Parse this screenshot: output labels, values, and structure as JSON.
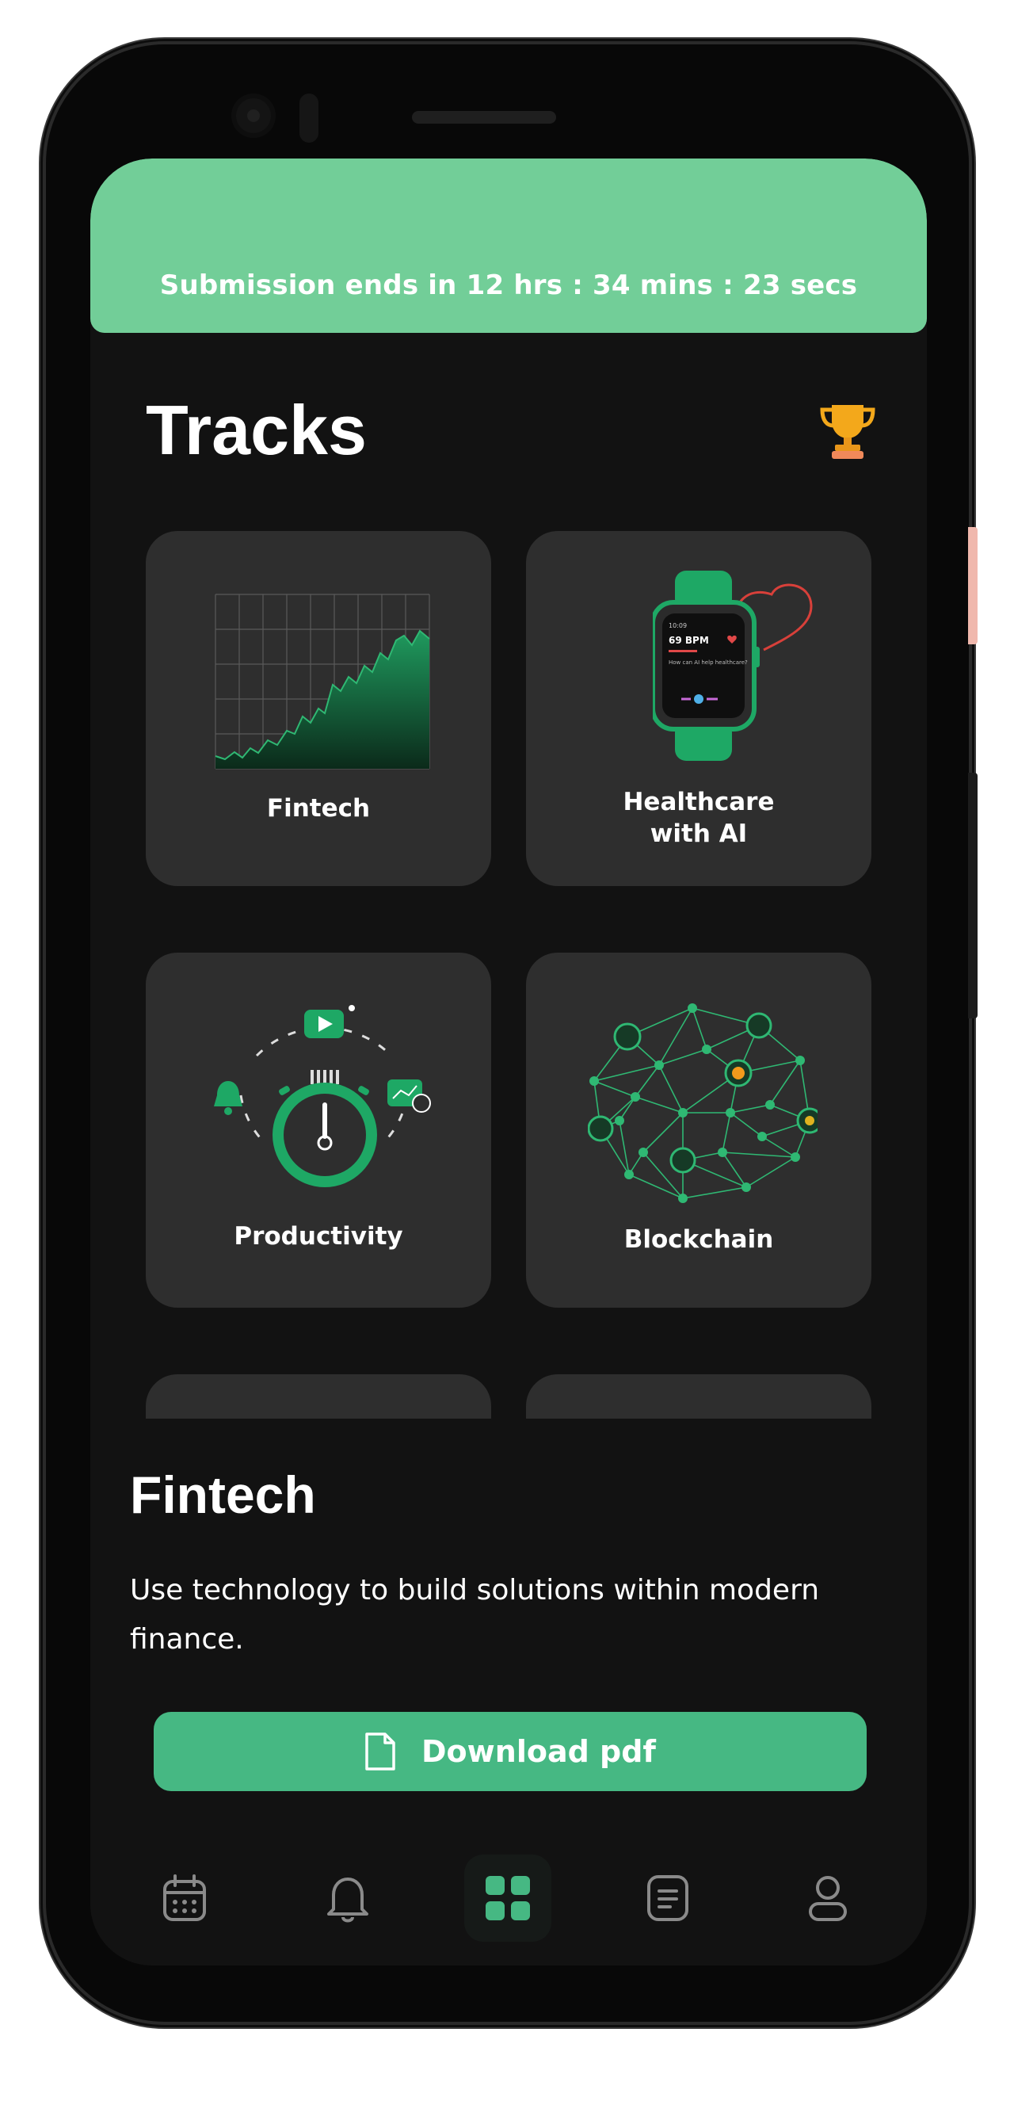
{
  "banner": {
    "countdown_text": "Submission ends in 12 hrs : 34 mins : 23 secs",
    "color": "#72ce98"
  },
  "header": {
    "title": "Tracks",
    "trophy_icon": "trophy-icon"
  },
  "tracks": [
    {
      "label": "Fintech",
      "illustration": "area-chart"
    },
    {
      "label": "Healthcare\nwith AI",
      "illustration": "smartwatch-heart"
    },
    {
      "label": "Productivity",
      "illustration": "stopwatch"
    },
    {
      "label": "Blockchain",
      "illustration": "network-nodes"
    }
  ],
  "watch": {
    "time": "10:09",
    "bpm": "69 BPM",
    "question": "How can AI help healthcare?"
  },
  "detail": {
    "title": "Fintech",
    "description": "Use technology to build solutions within modern finance.",
    "download_label": "Download pdf",
    "accent": "#46b883"
  },
  "nav": {
    "items": [
      "calendar-icon",
      "bell-icon",
      "grid-icon",
      "document-icon",
      "profile-icon"
    ],
    "active": "grid-icon"
  }
}
